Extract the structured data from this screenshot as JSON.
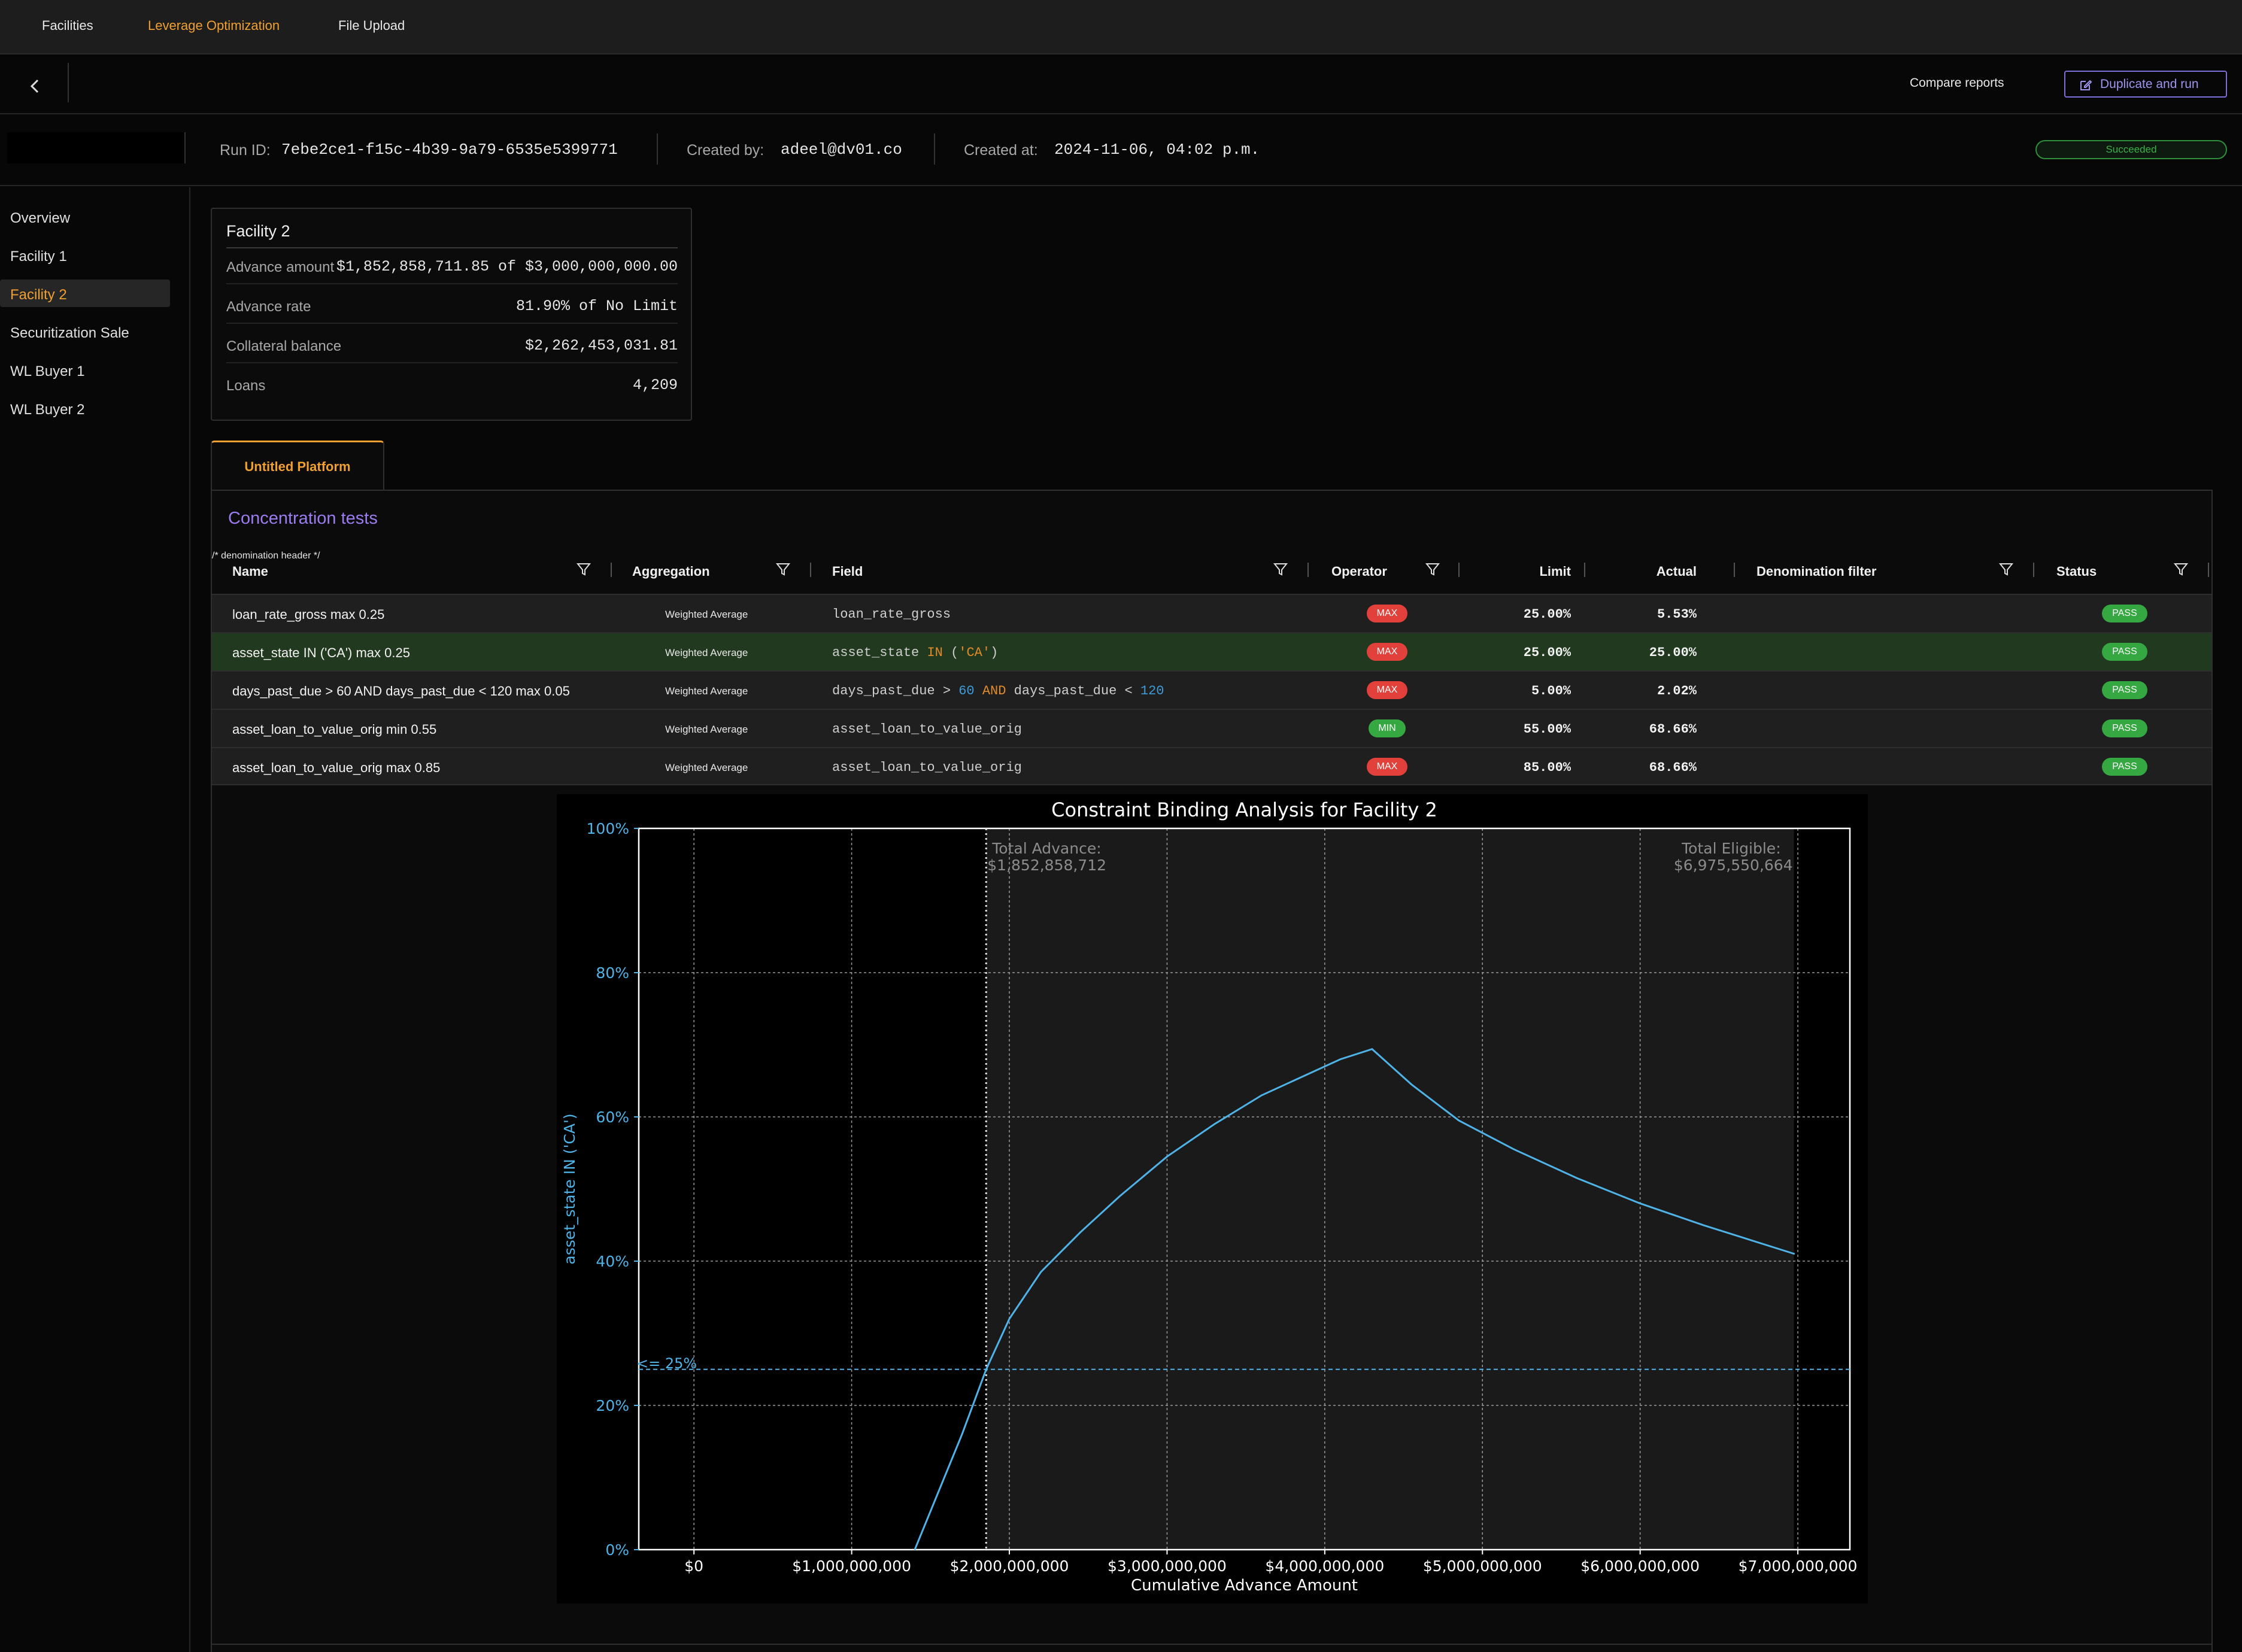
{
  "topnav": {
    "items": [
      {
        "label": "Facilities",
        "active": false
      },
      {
        "label": "Leverage Optimization",
        "active": true
      },
      {
        "label": "File Upload",
        "active": false
      }
    ]
  },
  "toolbar": {
    "compare_label": "Compare reports",
    "duplicate_label": "Duplicate and run"
  },
  "info": {
    "run_id_label": "Run ID:",
    "run_id": "7ebe2ce1-f15c-4b39-9a79-6535e5399771",
    "created_by_label": "Created by:",
    "created_by": "adeel@dv01.co",
    "created_at_label": "Created at:",
    "created_at": "2024-11-06, 04:02 p.m.",
    "status": "Succeeded"
  },
  "sidebar": {
    "items": [
      {
        "label": "Overview",
        "active": false
      },
      {
        "label": "Facility 1",
        "active": false
      },
      {
        "label": "Facility 2",
        "active": true
      },
      {
        "label": "Securitization Sale",
        "active": false
      },
      {
        "label": "WL Buyer 1",
        "active": false
      },
      {
        "label": "WL Buyer 2",
        "active": false
      }
    ]
  },
  "facility_card": {
    "title": "Facility 2",
    "rows": [
      {
        "label": "Advance amount",
        "value": "$1,852,858,711.85 of $3,000,000,000.00"
      },
      {
        "label": "Advance rate",
        "value": "81.90% of No Limit"
      },
      {
        "label": "Collateral balance",
        "value": "$2,262,453,031.81"
      },
      {
        "label": "Loans",
        "value": "4,209"
      }
    ]
  },
  "tab": {
    "label": "Untitled Platform"
  },
  "concentration": {
    "title": "Concentration tests",
    "columns": {
      "name": "Name",
      "aggregation": "Aggregation",
      "field": "Field",
      "operator": "Operator",
      "limit": "Limit",
      "actual": "Actual",
      "denomination": "Denomination filter",
      "status": "Status"
    },
    "rows": [
      {
        "name": "loan_rate_gross max 0.25",
        "aggregation": "Weighted Average",
        "field_plain": "loan_rate_gross",
        "operator": "MAX",
        "limit": "25.00%",
        "actual": "5.53%",
        "status": "PASS"
      },
      {
        "name": "asset_state IN ('CA') max 0.25",
        "aggregation": "Weighted Average",
        "field_plain": "asset_state IN ('CA')",
        "operator": "MAX",
        "limit": "25.00%",
        "actual": "25.00%",
        "status": "PASS"
      },
      {
        "name": "days_past_due > 60 AND days_past_due < 120 max 0.05",
        "aggregation": "Weighted Average",
        "field_plain": "days_past_due > 60 AND days_past_due < 120",
        "operator": "MAX",
        "limit": "5.00%",
        "actual": "2.02%",
        "status": "PASS"
      },
      {
        "name": "asset_loan_to_value_orig min 0.55",
        "aggregation": "Weighted Average",
        "field_plain": "asset_loan_to_value_orig",
        "operator": "MIN",
        "limit": "55.00%",
        "actual": "68.66%",
        "status": "PASS"
      },
      {
        "name": "asset_loan_to_value_orig max 0.85",
        "aggregation": "Weighted Average",
        "field_plain": "asset_loan_to_value_orig",
        "operator": "MAX",
        "limit": "85.00%",
        "actual": "68.66%",
        "status": "PASS"
      }
    ],
    "highlighted_row": 1
  },
  "chart_data": {
    "type": "line",
    "title": "Constraint Binding Analysis for Facility 2",
    "xlabel": "Cumulative Advance Amount",
    "ylabel": "asset_state IN ('CA')",
    "xlim": [
      -350000000,
      7330000000
    ],
    "ylim": [
      0,
      1
    ],
    "x_ticks": [
      0,
      1000000000,
      2000000000,
      3000000000,
      4000000000,
      5000000000,
      6000000000,
      7000000000
    ],
    "x_tick_labels": [
      "$0",
      "$1,000,000,000",
      "$2,000,000,000",
      "$3,000,000,000",
      "$4,000,000,000",
      "$5,000,000,000",
      "$6,000,000,000",
      "$7,000,000,000"
    ],
    "y_ticks": [
      0,
      0.2,
      0.4,
      0.6,
      0.8,
      1.0
    ],
    "y_tick_labels": [
      "0%",
      "20%",
      "40%",
      "60%",
      "80%",
      "100%"
    ],
    "grid": true,
    "series": [
      {
        "color": "#4fb3e8",
        "x": [
          1400000000,
          1550000000,
          1700000000,
          1852858712,
          2000000000,
          2200000000,
          2450000000,
          2700000000,
          3000000000,
          3300000000,
          3600000000,
          3900000000,
          4100000000,
          4300000000,
          4550000000,
          4850000000,
          5200000000,
          5600000000,
          6000000000,
          6400000000,
          6980000000
        ],
        "y": [
          0.0,
          0.08,
          0.16,
          0.25,
          0.32,
          0.385,
          0.44,
          0.49,
          0.545,
          0.59,
          0.63,
          0.66,
          0.68,
          0.694,
          0.645,
          0.595,
          0.555,
          0.515,
          0.48,
          0.45,
          0.41
        ]
      }
    ],
    "limit_line": {
      "y": 0.25,
      "label": "<= 25%",
      "color": "#4fb3e8"
    },
    "total_advance": {
      "x": 1852858712,
      "label": "Total Advance:",
      "value": "$1,852,858,712"
    },
    "total_eligible": {
      "x": 6975550664,
      "label": "Total Eligible:",
      "value": "$6,975,550,664"
    },
    "colors": {
      "background": "#000000",
      "shaded_region": "#1a1a1a",
      "tick_text": "#4fb3e8",
      "axis_text": "#ffffff",
      "annotation_text": "#8c8c8c"
    }
  }
}
